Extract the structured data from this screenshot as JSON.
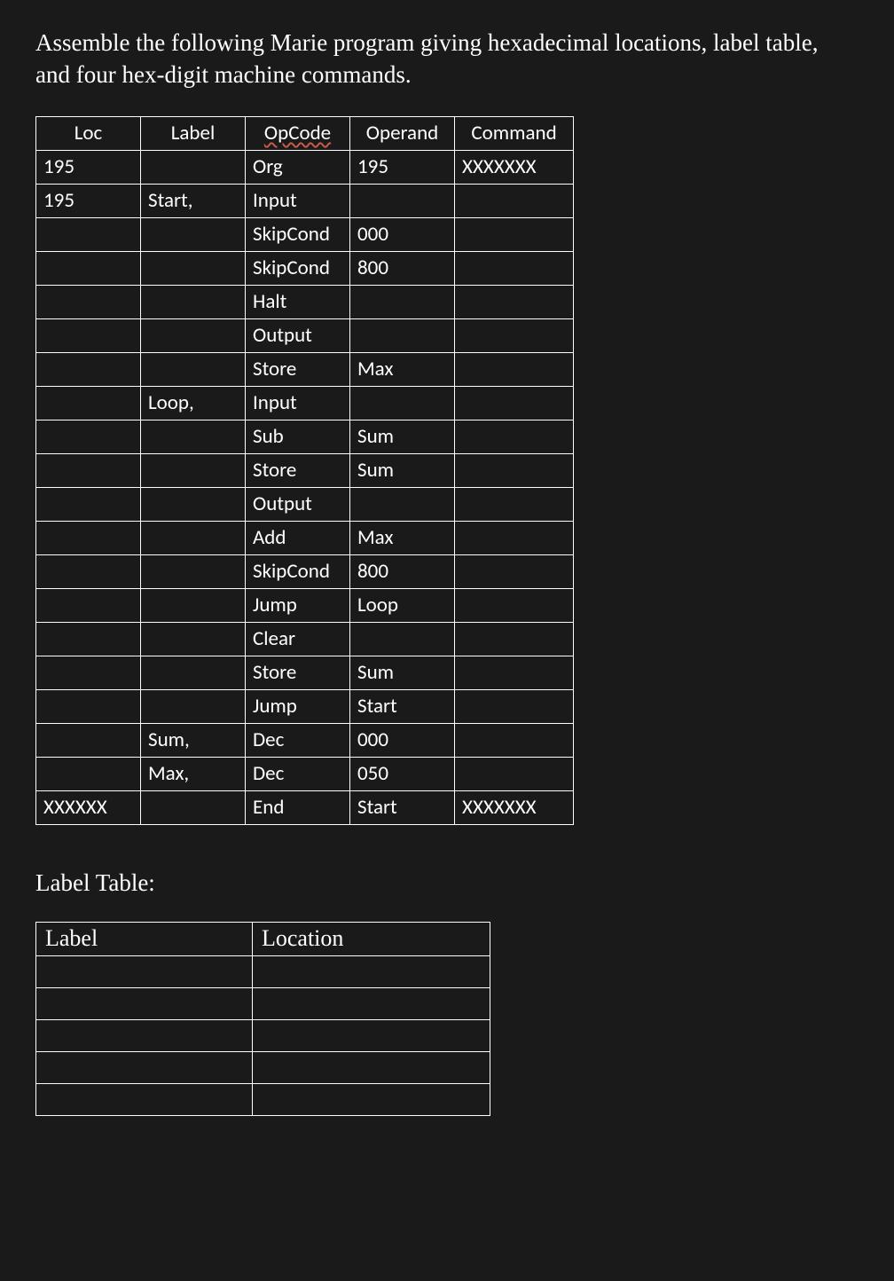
{
  "prompt": "Assemble the following Marie program giving hexadecimal locations, label table, and four hex-digit machine commands.",
  "program_table": {
    "headers": {
      "loc": "Loc",
      "label": "Label",
      "opcode": "OpCode",
      "operand": "Operand",
      "command": "Command"
    },
    "rows": [
      {
        "loc": "195",
        "label": "",
        "opcode": "Org",
        "operand": "195",
        "command": "XXXXXXX"
      },
      {
        "loc": "195",
        "label": "Start,",
        "opcode": "Input",
        "operand": "",
        "command": ""
      },
      {
        "loc": "",
        "label": "",
        "opcode": "SkipCond",
        "operand": "000",
        "command": ""
      },
      {
        "loc": "",
        "label": "",
        "opcode": "SkipCond",
        "operand": "800",
        "command": ""
      },
      {
        "loc": "",
        "label": "",
        "opcode": "Halt",
        "operand": "",
        "command": ""
      },
      {
        "loc": "",
        "label": "",
        "opcode": "Output",
        "operand": "",
        "command": ""
      },
      {
        "loc": "",
        "label": "",
        "opcode": "Store",
        "operand": "Max",
        "command": ""
      },
      {
        "loc": "",
        "label": "Loop,",
        "opcode": "Input",
        "operand": "",
        "command": ""
      },
      {
        "loc": "",
        "label": "",
        "opcode": "Sub",
        "operand": "Sum",
        "command": ""
      },
      {
        "loc": "",
        "label": "",
        "opcode": "Store",
        "operand": "Sum",
        "command": ""
      },
      {
        "loc": "",
        "label": "",
        "opcode": "Output",
        "operand": "",
        "command": ""
      },
      {
        "loc": "",
        "label": "",
        "opcode": "Add",
        "operand": "Max",
        "command": ""
      },
      {
        "loc": "",
        "label": "",
        "opcode": "SkipCond",
        "operand": "800",
        "command": ""
      },
      {
        "loc": "",
        "label": "",
        "opcode": "Jump",
        "operand": "Loop",
        "command": ""
      },
      {
        "loc": "",
        "label": "",
        "opcode": "Clear",
        "operand": "",
        "command": ""
      },
      {
        "loc": "",
        "label": "",
        "opcode": "Store",
        "operand": "Sum",
        "command": ""
      },
      {
        "loc": "",
        "label": "",
        "opcode": "Jump",
        "operand": "Start",
        "command": ""
      },
      {
        "loc": "",
        "label": "Sum,",
        "opcode": "Dec",
        "operand": "000",
        "command": ""
      },
      {
        "loc": "",
        "label": "Max,",
        "opcode": "Dec",
        "operand": "050",
        "command": ""
      },
      {
        "loc": "XXXXXX",
        "label": "",
        "opcode": "End",
        "operand": "Start",
        "command": "XXXXXXX"
      }
    ]
  },
  "label_section_title": "Label Table:",
  "label_table": {
    "headers": {
      "label": "Label",
      "location": "Location"
    },
    "rows": [
      {
        "label": "",
        "location": ""
      },
      {
        "label": "",
        "location": ""
      },
      {
        "label": "",
        "location": ""
      },
      {
        "label": "",
        "location": ""
      },
      {
        "label": "",
        "location": ""
      }
    ]
  }
}
